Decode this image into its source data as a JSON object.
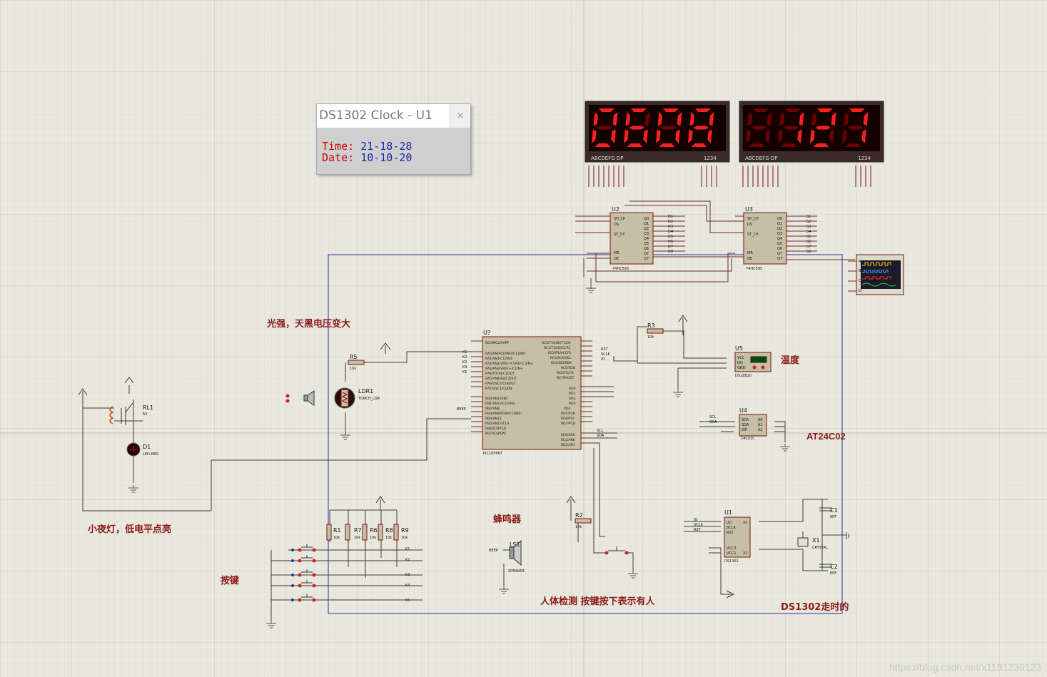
{
  "popup": {
    "title": "DS1302 Clock - U1",
    "close": "×",
    "time_label": "Time:",
    "time_value": "21-18-28",
    "date_label": "Date:",
    "date_value": "10-10-20"
  },
  "displays": [
    {
      "digits": "0608",
      "pins": "ABCDEFG  DP",
      "pins_right": "1234"
    },
    {
      "digits": "8127",
      "pins": "ABCDEFG  DP",
      "pins_right": "1234"
    }
  ],
  "annotations": {
    "light": "光强，天黑电压变大",
    "temp": "温度",
    "eeprom": "AT24C02",
    "night_light": "小夜灯，低电平点亮",
    "buzzer": "蜂鸣器",
    "keys": "按键",
    "human": "人体检测 按键按下表示有人",
    "ds1302": "DS1302走时的"
  },
  "components": {
    "u2": "U2",
    "u3": "U3",
    "chip_595": "74HC595",
    "u7": "U?",
    "mcu": "PIC16F887",
    "u5": "U5",
    "ds18b20": "DS18B20",
    "u4": "U4",
    "eeprom_chip": "24C02C",
    "u1": "U1",
    "rtc": "DS1302",
    "r5": "R5",
    "r3": "R3",
    "r2": "R2",
    "r1": "R1",
    "r7": "R7",
    "r6": "R6",
    "r8": "R8",
    "r9": "R9",
    "r_val": "10k",
    "ldr": "LDR1",
    "ldr_type": "TORCH_LDR",
    "rl1": "RL1",
    "rl_val": "5V",
    "d1": "D1",
    "d1_type": "LED-RED",
    "ls1": "LS1",
    "speaker": "SPEAKER",
    "x1": "X1",
    "crystal": "CRYSTAL",
    "c1": "C1",
    "c2": "C2",
    "c_val": "6PF"
  },
  "nets": {
    "k": [
      "K1",
      "K2",
      "K3",
      "K4",
      "K5"
    ],
    "s": [
      "S1",
      "S2",
      "S3",
      "S4",
      "S5",
      "S6",
      "S7",
      "S8"
    ],
    "d": [
      "D1",
      "D2",
      "D3",
      "D4",
      "D5",
      "D6",
      "D7",
      "D8"
    ],
    "beep": "BEEP",
    "rst": "RST",
    "sclk": "SCLK",
    "io": "IO",
    "scl": "SCL",
    "sda": "SDA"
  },
  "watermark": "https://blog.csdn.net/x1131230123",
  "colors": {
    "background": "#e9e8de",
    "wire": "#1a1a8a",
    "component_body": "#c7bfa5",
    "component_outline": "#7a1010",
    "label_red": "#8a1a1a",
    "segment_on": "#ff2020",
    "segment_off": "#6e0000",
    "display_bg": "#1a0000",
    "scope_screen": "#1a1a2a"
  }
}
